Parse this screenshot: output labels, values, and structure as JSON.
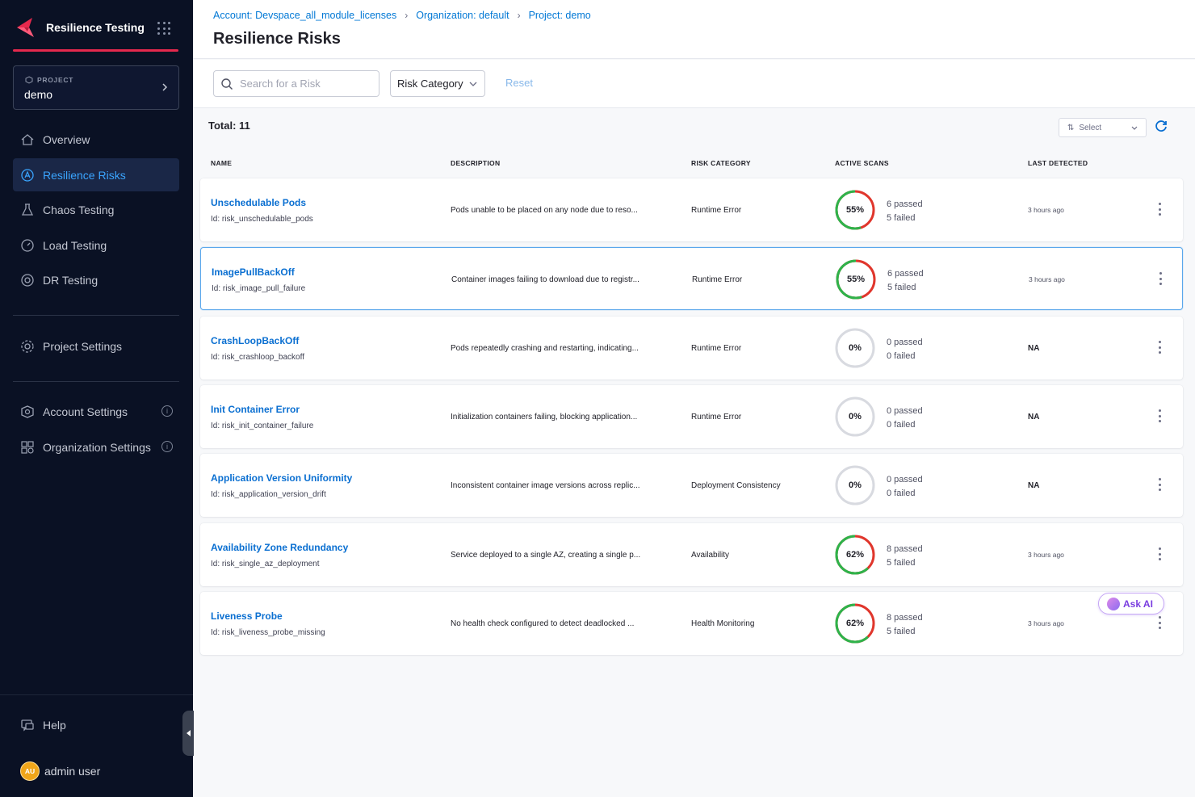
{
  "sidebar": {
    "brand_title": "Resilience Testing",
    "project_label": "PROJECT",
    "project_name": "demo",
    "nav": [
      {
        "label": "Overview",
        "icon": "home-icon"
      },
      {
        "label": "Resilience Risks",
        "icon": "risk-icon",
        "active": true
      },
      {
        "label": "Chaos Testing",
        "icon": "flask-icon"
      },
      {
        "label": "Load Testing",
        "icon": "gauge-icon"
      },
      {
        "label": "DR Testing",
        "icon": "shield-icon"
      }
    ],
    "project_settings": "Project Settings",
    "account_settings": "Account Settings",
    "organization_settings": "Organization Settings",
    "help": "Help",
    "user_initials": "AU",
    "user_name": "admin user",
    "accent_color": "#e5294d"
  },
  "header": {
    "breadcrumbs": [
      "Account: Devspace_all_module_licenses",
      "Organization: default",
      "Project: demo"
    ],
    "title": "Resilience Risks"
  },
  "filters": {
    "search_placeholder": "Search for a Risk",
    "risk_category": "Risk Category",
    "reset": "Reset"
  },
  "table": {
    "total_label": "Total: 11",
    "sort_label": "Select",
    "columns": [
      "NAME",
      "DESCRIPTION",
      "RISK CATEGORY",
      "ACTIVE SCANS",
      "LAST DETECTED"
    ],
    "rows": [
      {
        "name": "Unschedulable Pods",
        "id": "Id: risk_unschedulable_pods",
        "description": "Pods unable to be placed on any node due to reso...",
        "category": "Runtime Error",
        "percent": "55%",
        "pct_value": 55,
        "passed": "6 passed",
        "failed": "5 failed",
        "last_detected": "3 hours ago"
      },
      {
        "name": "ImagePullBackOff",
        "id": "Id: risk_image_pull_failure",
        "description": "Container images failing to download due to registr...",
        "category": "Runtime Error",
        "percent": "55%",
        "pct_value": 55,
        "passed": "6 passed",
        "failed": "5 failed",
        "last_detected": "3 hours ago"
      },
      {
        "name": "CrashLoopBackOff",
        "id": "Id: risk_crashloop_backoff",
        "description": "Pods repeatedly crashing and restarting, indicating...",
        "category": "Runtime Error",
        "percent": "0%",
        "pct_value": 0,
        "passed": "0 passed",
        "failed": "0 failed",
        "last_detected": "NA"
      },
      {
        "name": "Init Container Error",
        "id": "Id: risk_init_container_failure",
        "description": "Initialization containers failing, blocking application...",
        "category": "Runtime Error",
        "percent": "0%",
        "pct_value": 0,
        "passed": "0 passed",
        "failed": "0 failed",
        "last_detected": "NA"
      },
      {
        "name": "Application Version Uniformity",
        "id": "Id: risk_application_version_drift",
        "description": "Inconsistent container image versions across replic...",
        "category": "Deployment Consistency",
        "percent": "0%",
        "pct_value": 0,
        "passed": "0 passed",
        "failed": "0 failed",
        "last_detected": "NA"
      },
      {
        "name": "Availability Zone Redundancy",
        "id": "Id: risk_single_az_deployment",
        "description": "Service deployed to a single AZ, creating a single p...",
        "category": "Availability",
        "percent": "62%",
        "pct_value": 62,
        "passed": "8 passed",
        "failed": "5 failed",
        "last_detected": "3 hours ago"
      },
      {
        "name": "Liveness Probe",
        "id": "Id: risk_liveness_probe_missing",
        "description": "No health check configured to detect deadlocked ...",
        "category": "Health Monitoring",
        "percent": "62%",
        "pct_value": 62,
        "passed": "8 passed",
        "failed": "5 failed",
        "last_detected": "3 hours ago"
      }
    ]
  },
  "ask_ai": "Ask AI",
  "colors": {
    "pass": "#2eb34a",
    "fail": "#e0362c",
    "empty": "#d8dae0",
    "link": "#0a6fd1"
  }
}
